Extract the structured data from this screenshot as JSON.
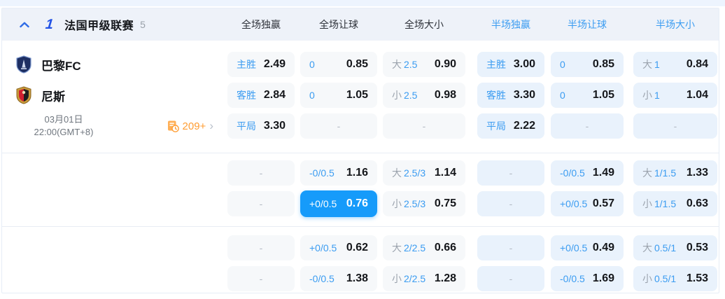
{
  "colors": {
    "accent_selected": "#169bfa",
    "label_blue": "#3b9cf1",
    "half_header_blue": "#3b9cf1",
    "brand_blue": "#2353e6",
    "orange": "#ff9d33",
    "header_bg": "#eef2f9",
    "fulltime_cell_bg": "#f6f8fa",
    "halftime_cell_bg": "#e9f2fc"
  },
  "top_bar": {
    "league": "法国甲级联赛",
    "count": "5",
    "column_headers_full": [
      "全场独赢",
      "全场让球",
      "全场大小"
    ],
    "column_headers_half": [
      "半场独赢",
      "半场让球",
      "半场大小"
    ]
  },
  "match": {
    "home_team": "巴黎FC",
    "away_team": "尼斯",
    "date": "03月01日",
    "time": "22:00(GMT+8)",
    "more_markets": "209+"
  },
  "odds_rows": [
    {
      "cells": [
        {
          "label": "主胜",
          "value": "2.49"
        },
        {
          "label": "0",
          "value": "0.85"
        },
        {
          "prefix": "大",
          "line": "2.5",
          "value": "0.90"
        },
        {
          "label": "主胜",
          "value": "3.00"
        },
        {
          "label": "0",
          "value": "0.85"
        },
        {
          "prefix": "大",
          "line": "1",
          "value": "0.84"
        }
      ]
    },
    {
      "cells": [
        {
          "label": "客胜",
          "value": "2.84"
        },
        {
          "label": "0",
          "value": "1.05"
        },
        {
          "prefix": "小",
          "line": "2.5",
          "value": "0.98"
        },
        {
          "label": "客胜",
          "value": "3.30"
        },
        {
          "label": "0",
          "value": "1.05"
        },
        {
          "prefix": "小",
          "line": "1",
          "value": "1.04"
        }
      ]
    },
    {
      "cells": [
        {
          "label": "平局",
          "value": "3.30"
        },
        {
          "value": "-"
        },
        {
          "value": "-"
        },
        {
          "label": "平局",
          "value": "2.22"
        },
        {
          "value": "-"
        },
        {
          "value": "-"
        }
      ]
    },
    {
      "cells": [
        {
          "value": "-"
        },
        {
          "label": "-0/0.5",
          "value": "1.16"
        },
        {
          "prefix": "大",
          "line": "2.5/3",
          "value": "1.14"
        },
        {
          "value": "-"
        },
        {
          "label": "-0/0.5",
          "value": "1.49"
        },
        {
          "prefix": "大",
          "line": "1/1.5",
          "value": "1.33"
        }
      ]
    },
    {
      "cells": [
        {
          "value": "-"
        },
        {
          "label": "+0/0.5",
          "value": "0.76",
          "selected": true
        },
        {
          "prefix": "小",
          "line": "2.5/3",
          "value": "0.75"
        },
        {
          "value": "-"
        },
        {
          "label": "+0/0.5",
          "value": "0.57"
        },
        {
          "prefix": "小",
          "line": "1/1.5",
          "value": "0.63"
        }
      ]
    },
    {
      "cells": [
        {
          "value": "-"
        },
        {
          "label": "+0/0.5",
          "value": "0.62"
        },
        {
          "prefix": "大",
          "line": "2/2.5",
          "value": "0.66"
        },
        {
          "value": "-"
        },
        {
          "label": "+0/0.5",
          "value": "0.49"
        },
        {
          "prefix": "大",
          "line": "0.5/1",
          "value": "0.53"
        }
      ]
    },
    {
      "cells": [
        {
          "value": "-"
        },
        {
          "label": "-0/0.5",
          "value": "1.38"
        },
        {
          "prefix": "小",
          "line": "2/2.5",
          "value": "1.28"
        },
        {
          "value": "-"
        },
        {
          "label": "-0/0.5",
          "value": "1.69"
        },
        {
          "prefix": "小",
          "line": "0.5/1",
          "value": "1.53"
        }
      ]
    }
  ]
}
